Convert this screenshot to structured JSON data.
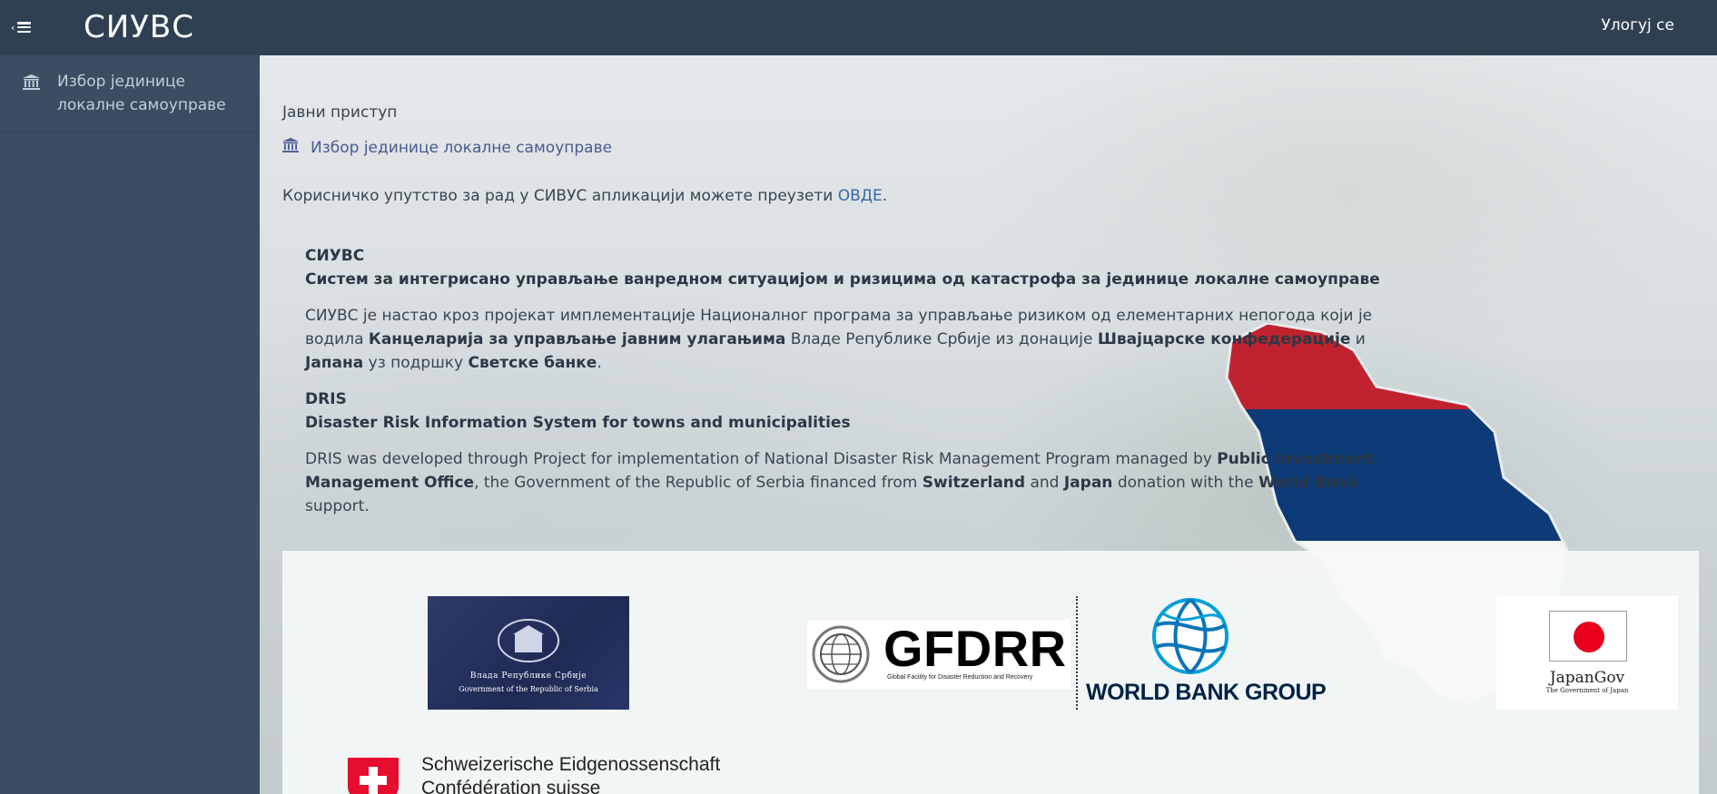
{
  "header": {
    "brand": "СИУВС",
    "login_label": "Улогуј се",
    "menu_icon": "hamburger-icon"
  },
  "sidebar": {
    "items": [
      {
        "label": "Избор јединице локалне самоуправе",
        "icon": "institution-icon"
      }
    ]
  },
  "main": {
    "public_heading": "Јавни приступ",
    "municipality_link": "Избор јединице локалне самоуправе",
    "manual_text": "Корисничко упутство за рад у СИВУС апликацији можете преузети",
    "manual_link": "ОВДЕ",
    "manual_end": ".",
    "sr": {
      "acronym": "СИУВС",
      "full_name": "Систем за интегрисано управљање ванредном ситуацијом и ризицима од катастрофа за јединице локалне самоуправе",
      "p1": "СИУВС је настао кроз пројекат имплементације Националног програма за управљање ризиком од елементарних непогода који је водила",
      "b1": "Канцеларија за управљање јавним улагањима",
      "p2": "Владе Републике Србије из донације",
      "b2": "Швајцарске конфедерације",
      "p3": "и",
      "b3": "Јапана",
      "p4": "уз подршку",
      "b4": "Светске банке",
      "p5": "."
    },
    "en": {
      "acronym": "DRIS",
      "full_name": "Disaster Risk Information System for towns and municipalities",
      "p1": "DRIS was developed through Project for implementation of National Disaster Risk Management Program managed by",
      "b1": "Public Investment Management Office",
      "p2": ", the Government of the Republic of Serbia financed from",
      "b2": "Switzerland",
      "p3": "and",
      "b3": "Japan",
      "p4": "donation with the",
      "b4": "World Bank",
      "p5": "support."
    }
  },
  "logos": {
    "serbia_gov": {
      "line1": "Влада Републике Србије",
      "line2": "Government of the Republic of Serbia"
    },
    "gfdrr": {
      "name": "GFDRR",
      "subtitle": "Global Facility for Disaster Reduction and Recovery"
    },
    "world_bank": {
      "name": "WORLD BANK GROUP"
    },
    "japan": {
      "name": "JapanGov",
      "subtitle": "The Government of Japan"
    },
    "swiss": {
      "line1": "Schweizerische Eidgenossenschaft",
      "line2": "Confédération suisse"
    }
  },
  "colors": {
    "topbar": "#2f4052",
    "sidebar": "#3a4d63",
    "link": "#3a67a6",
    "flag_red": "#c0232f",
    "flag_blue": "#0d3b78"
  }
}
